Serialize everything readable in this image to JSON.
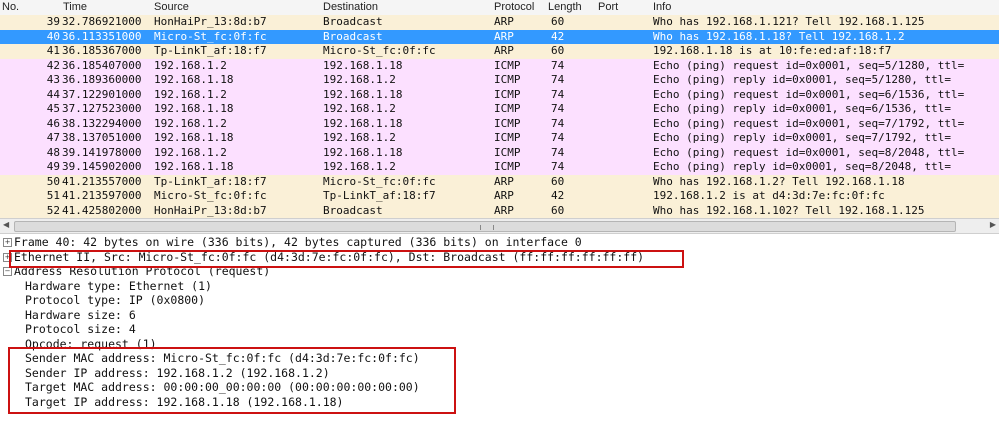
{
  "columns": [
    "No.",
    "Time",
    "Source",
    "Destination",
    "Protocol",
    "Length",
    "Port",
    "Info"
  ],
  "packets": [
    {
      "no": "39",
      "time": "32.786921000",
      "src": "HonHaiPr_13:8d:b7",
      "dst": "Broadcast",
      "proto": "ARP",
      "len": "60",
      "info": "Who has 192.168.1.121?  Tell 192.168.1.125"
    },
    {
      "no": "40",
      "time": "36.113351000",
      "src": "Micro-St_fc:0f:fc",
      "dst": "Broadcast",
      "proto": "ARP",
      "len": "42",
      "info": "Who has 192.168.1.18?  Tell 192.168.1.2"
    },
    {
      "no": "41",
      "time": "36.185367000",
      "src": "Tp-LinkT_af:18:f7",
      "dst": "Micro-St_fc:0f:fc",
      "proto": "ARP",
      "len": "60",
      "info": "192.168.1.18 is at 10:fe:ed:af:18:f7"
    },
    {
      "no": "42",
      "time": "36.185407000",
      "src": "192.168.1.2",
      "dst": "192.168.1.18",
      "proto": "ICMP",
      "len": "74",
      "info": "Echo (ping) request  id=0x0001, seq=5/1280, ttl="
    },
    {
      "no": "43",
      "time": "36.189360000",
      "src": "192.168.1.18",
      "dst": "192.168.1.2",
      "proto": "ICMP",
      "len": "74",
      "info": "Echo (ping) reply    id=0x0001, seq=5/1280, ttl="
    },
    {
      "no": "44",
      "time": "37.122901000",
      "src": "192.168.1.2",
      "dst": "192.168.1.18",
      "proto": "ICMP",
      "len": "74",
      "info": "Echo (ping) request  id=0x0001, seq=6/1536, ttl="
    },
    {
      "no": "45",
      "time": "37.127523000",
      "src": "192.168.1.18",
      "dst": "192.168.1.2",
      "proto": "ICMP",
      "len": "74",
      "info": "Echo (ping) reply    id=0x0001, seq=6/1536, ttl="
    },
    {
      "no": "46",
      "time": "38.132294000",
      "src": "192.168.1.2",
      "dst": "192.168.1.18",
      "proto": "ICMP",
      "len": "74",
      "info": "Echo (ping) request  id=0x0001, seq=7/1792, ttl="
    },
    {
      "no": "47",
      "time": "38.137051000",
      "src": "192.168.1.18",
      "dst": "192.168.1.2",
      "proto": "ICMP",
      "len": "74",
      "info": "Echo (ping) reply    id=0x0001, seq=7/1792, ttl="
    },
    {
      "no": "48",
      "time": "39.141978000",
      "src": "192.168.1.2",
      "dst": "192.168.1.18",
      "proto": "ICMP",
      "len": "74",
      "info": "Echo (ping) request  id=0x0001, seq=8/2048, ttl="
    },
    {
      "no": "49",
      "time": "39.145902000",
      "src": "192.168.1.18",
      "dst": "192.168.1.2",
      "proto": "ICMP",
      "len": "74",
      "info": "Echo (ping) reply    id=0x0001, seq=8/2048, ttl="
    },
    {
      "no": "50",
      "time": "41.213557000",
      "src": "Tp-LinkT_af:18:f7",
      "dst": "Micro-St_fc:0f:fc",
      "proto": "ARP",
      "len": "60",
      "info": "Who has 192.168.1.2?  Tell 192.168.1.18"
    },
    {
      "no": "51",
      "time": "41.213597000",
      "src": "Micro-St_fc:0f:fc",
      "dst": "Tp-LinkT_af:18:f7",
      "proto": "ARP",
      "len": "42",
      "info": "192.168.1.2 is at d4:3d:7e:fc:0f:fc"
    },
    {
      "no": "52",
      "time": "41.425802000",
      "src": "HonHaiPr_13:8d:b7",
      "dst": "Broadcast",
      "proto": "ARP",
      "len": "60",
      "info": "Who has 192.168.1.102?  Tell 192.168.1.125"
    }
  ],
  "selected_row": "40",
  "colors": {
    "arp_row": "#faf0d7",
    "icmp_row": "#fce0ff",
    "selected_row": "#3399ff",
    "highlight_box": "#cc1111"
  },
  "details": {
    "frame": "Frame 40: 42 bytes on wire (336 bits), 42 bytes captured (336 bits) on interface 0",
    "ethernet": "Ethernet II, Src: Micro-St_fc:0f:fc (d4:3d:7e:fc:0f:fc), Dst: Broadcast (ff:ff:ff:ff:ff:ff)",
    "arp": "Address Resolution Protocol (request)",
    "arp_fields": [
      "Hardware type: Ethernet (1)",
      "Protocol type: IP (0x0800)",
      "Hardware size: 6",
      "Protocol size: 4",
      "Opcode: request (1)",
      "Sender MAC address: Micro-St_fc:0f:fc (d4:3d:7e:fc:0f:fc)",
      "Sender IP address: 192.168.1.2 (192.168.1.2)",
      "Target MAC address: 00:00:00_00:00:00 (00:00:00:00:00:00)",
      "Target IP address: 192.168.1.18 (192.168.1.18)"
    ]
  }
}
